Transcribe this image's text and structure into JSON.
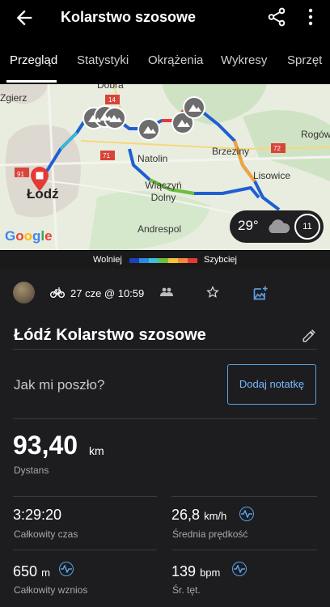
{
  "header": {
    "title": "Kolarstwo szosowe",
    "back_icon": "arrow-left-icon",
    "share_icon": "share-icon",
    "more_icon": "more-vertical-icon"
  },
  "tabs": [
    {
      "label": "Przegląd",
      "active": true
    },
    {
      "label": "Statystyki",
      "active": false
    },
    {
      "label": "Okrążenia",
      "active": false
    },
    {
      "label": "Wykresy",
      "active": false
    },
    {
      "label": "Sprzęt",
      "active": false
    }
  ],
  "map": {
    "places": [
      "Zgierz",
      "Łódź",
      "Natolin",
      "Brzeziny",
      "Lisowice",
      "Wiączyń Dolny",
      "Andrespol",
      "Rogów",
      "Dobra"
    ],
    "roads": [
      "91",
      "71",
      "72",
      "14"
    ],
    "google_label": "Google",
    "weather": {
      "temp": "29°",
      "icon": "cloud-icon",
      "wind": "11"
    }
  },
  "legend": {
    "slow": "Wolniej",
    "fast": "Szybciej"
  },
  "activity": {
    "date": "27 cze @ 10:59",
    "title": "Łódź Kolarstwo szosowe",
    "feel_prompt": "Jak mi poszło?",
    "add_note": "Dodaj notatkę"
  },
  "stats": {
    "distance": {
      "value": "93,40",
      "unit": "km",
      "label": "Dystans"
    },
    "total_time": {
      "value": "3:29:20",
      "label": "Całkowity czas"
    },
    "avg_speed": {
      "value": "26,8",
      "unit": "km/h",
      "label": "Średnia prędkość"
    },
    "ascent": {
      "value": "650",
      "unit": "m",
      "label": "Całkowity wznios"
    },
    "heart_rate": {
      "value": "139",
      "unit": "bpm",
      "label": "Śr. tęt."
    }
  },
  "colors": {
    "accent": "#5aa0e6",
    "background": "#1d1d1f",
    "route_marker": "#e53935"
  }
}
